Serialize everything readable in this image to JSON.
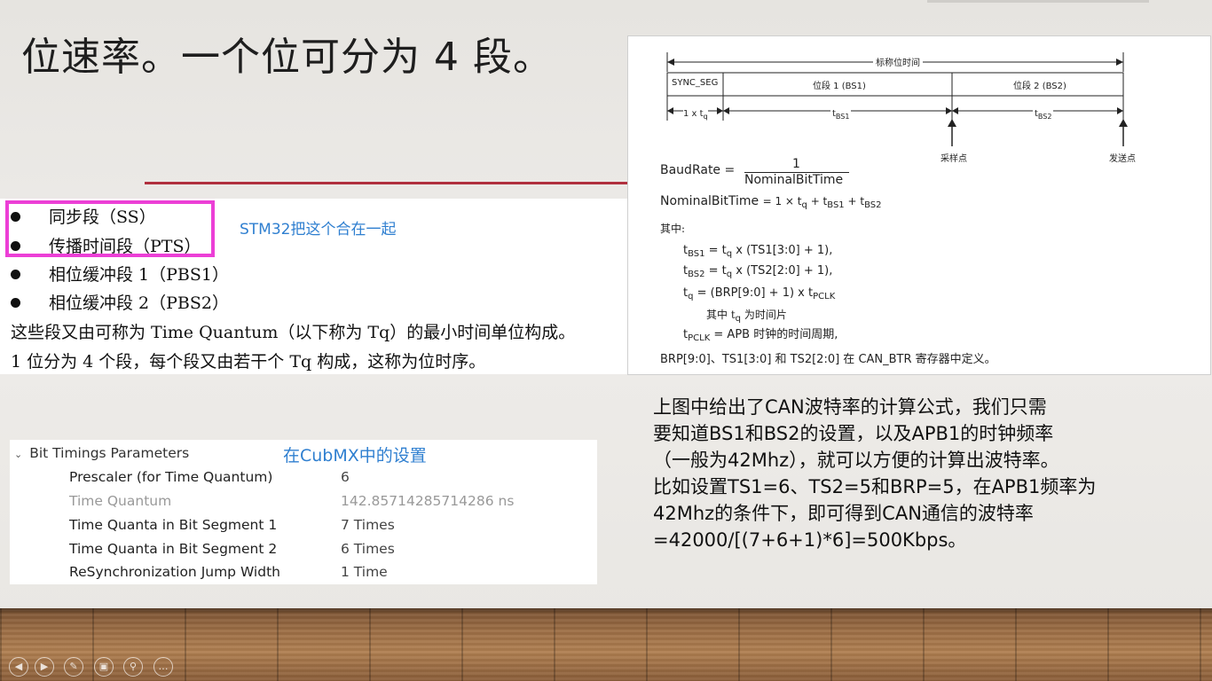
{
  "title": "位速率。一个位可分为 4 段。",
  "bullets": [
    "同步段（SS）",
    "传播时间段（PTS）",
    "相位缓冲段 1（PBS1）",
    "相位缓冲段 2（PBS2）"
  ],
  "paragraph": [
    "这些段又由可称为 Time Quantum（以下称为 Tq）的最小时间单位构成。",
    "1 位分为 4 个段，每个段又由若干个 Tq 构成，这称为位时序。"
  ],
  "stm_note": "STM32把这个合在一起",
  "timing_diagram": {
    "nominal_label": "标称位时间",
    "sync_seg": "SYNC_SEG",
    "seg1": "位段 1 (BS1)",
    "seg2": "位段 2 (BS2)",
    "tq_label": "1 x t",
    "tq_sub": "q",
    "tbs1": "t",
    "tbs1_sub": "BS1",
    "tbs2": "t",
    "tbs2_sub": "BS2",
    "sample_point": "采样点",
    "send_point": "发送点"
  },
  "formulas": {
    "baud_lhs": "BaudRate =",
    "baud_num": "1",
    "baud_den": "NominalBitTime",
    "nbt_lhs": "NominalBitTime",
    "nbt_eq": "= 1 × t",
    "nbt_q": "q",
    "nbt_plus1": " + t",
    "nbt_bs1": "BS1",
    "nbt_plus2": " + t",
    "nbt_bs2": "BS2",
    "where": "其中:",
    "f1_sub": "BS1",
    "f1_rest": " = t",
    "f1_q": "q",
    "f1_tail": " x (TS1[3:0] + 1),",
    "f2_sub": "BS2",
    "f2_rest": " = t",
    "f2_q": "q",
    "f2_tail": " x (TS2[2:0] + 1),",
    "f3_q": "q",
    "f3_tail": " = (BRP[9:0] + 1) x t",
    "f3_pclk": "PCLK",
    "f4_pre": "其中 t",
    "f4_q": "q",
    "f4_post": " 为时间片",
    "f5_sub": "PCLK",
    "f5_tail": " = APB 时钟的时间周期,",
    "footer": "BRP[9:0]、TS1[3:0] 和 TS2[2:0] 在 CAN_BTR 寄存器中定义。"
  },
  "description": [
    "上图中给出了CAN波特率的计算公式，我们只需",
    "要知道BS1和BS2的设置，以及APB1的时钟频率",
    "（一般为42Mhz），就可以方便的计算出波特率。",
    "比如设置TS1=6、TS2=5和BRP=5，在APB1频率为",
    "42Mhz的条件下，即可得到CAN通信的波特率",
    "=42000/[(7+6+1)*6]=500Kbps。"
  ],
  "cubemx": {
    "header": "Bit Timings Parameters",
    "note": "在CubMX中的设置",
    "rows": [
      {
        "label": "Prescaler (for Time Quantum)",
        "value": "6"
      },
      {
        "label": "Time Quantum",
        "value": "142.85714285714286 ns"
      },
      {
        "label": "Time Quanta in Bit Segment 1",
        "value": "7 Times"
      },
      {
        "label": "Time Quanta in Bit Segment 2",
        "value": "6 Times"
      },
      {
        "label": "ReSynchronization Jump Width",
        "value": "1 Time"
      }
    ]
  },
  "nav_icons": [
    "prev-icon",
    "next-icon",
    "pen-icon",
    "slides-icon",
    "zoom-icon",
    "more-icon"
  ]
}
